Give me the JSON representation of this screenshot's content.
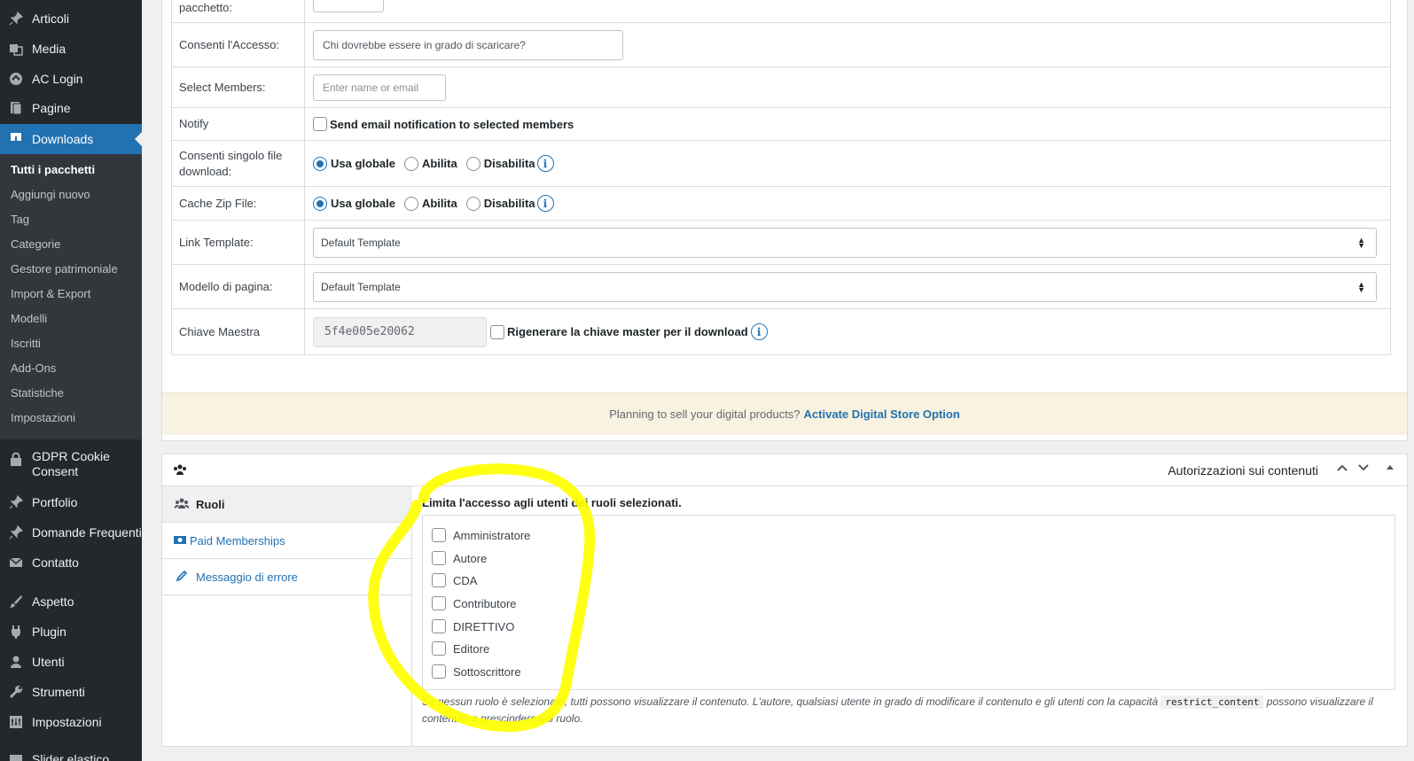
{
  "sidebar": {
    "items": [
      {
        "label": "Articoli",
        "icon": "pin-icon"
      },
      {
        "label": "Media",
        "icon": "media-icon"
      },
      {
        "label": "AC Login",
        "icon": "login-icon"
      },
      {
        "label": "Pagine",
        "icon": "pages-icon"
      },
      {
        "label": "Downloads",
        "icon": "download-icon"
      },
      {
        "label": "GDPR Cookie Consent",
        "icon": "lock-icon"
      },
      {
        "label": "Portfolio",
        "icon": "pin-icon"
      },
      {
        "label": "Domande Frequenti",
        "icon": "pin-icon"
      },
      {
        "label": "Contatto",
        "icon": "mail-icon"
      },
      {
        "label": "Aspetto",
        "icon": "brush-icon"
      },
      {
        "label": "Plugin",
        "icon": "plugin-icon"
      },
      {
        "label": "Utenti",
        "icon": "user-icon"
      },
      {
        "label": "Strumenti",
        "icon": "wrench-icon"
      },
      {
        "label": "Impostazioni",
        "icon": "settings-icon"
      },
      {
        "label": "Slider elastico",
        "icon": "slider-icon"
      }
    ],
    "submenu": [
      "Tutti i pacchetti",
      "Aggiungi nuovo",
      "Tag",
      "Categorie",
      "Gestore patrimoniale",
      "Import & Export",
      "Modelli",
      "Iscritti",
      "Add-Ons",
      "Statistiche",
      "Impostazioni"
    ]
  },
  "settings": {
    "package_label": "pacchetto:",
    "access_label": "Consenti l'Accesso:",
    "access_placeholder": "Chi dovrebbe essere in grado di scaricare?",
    "members_label": "Select Members:",
    "members_placeholder": "Enter name or email",
    "notify_label": "Notify",
    "notify_text": "Send email notification to selected members",
    "single_label": "Consenti singolo file download:",
    "cache_label": "Cache Zip File:",
    "opt_global": "Usa globale",
    "opt_enable": "Abilita",
    "opt_disable": "Disabilita",
    "link_template_label": "Link Template:",
    "link_template_value": "Default Template",
    "page_template_label": "Modello di pagina:",
    "page_template_value": "Default Template",
    "master_key_label": "Chiave Maestra",
    "master_key_value": "5f4e005e20062",
    "regen_label": "Rigenerare la chiave master per il download"
  },
  "promo": {
    "text": "Planning to sell your digital products?",
    "link": "Activate Digital Store Option"
  },
  "permissions": {
    "title": "Autorizzazioni sui contenuti",
    "tabs": [
      "Ruoli",
      "Paid Memberships",
      "Messaggio di errore"
    ],
    "heading": "Limita l'accesso agli utenti dei ruoli selezionati.",
    "roles": [
      "Amministratore",
      "Autore",
      "CDA",
      "Contributore",
      "DIRETTIVO",
      "Editore",
      "Sottoscrittore"
    ],
    "note_before": "Se nessun ruolo è selezionato, tutti possono visualizzare il contenuto. L'autore, qualsiasi utente in grado di modificare il contenuto e gli utenti con la capacità",
    "note_code": "restrict_content",
    "note_after": "possono visualizzare il contenuto a prescindere dal ruolo."
  },
  "colors": {
    "accent": "#2271b1",
    "sidebar": "#23282d",
    "highlight": "#ffff00"
  }
}
